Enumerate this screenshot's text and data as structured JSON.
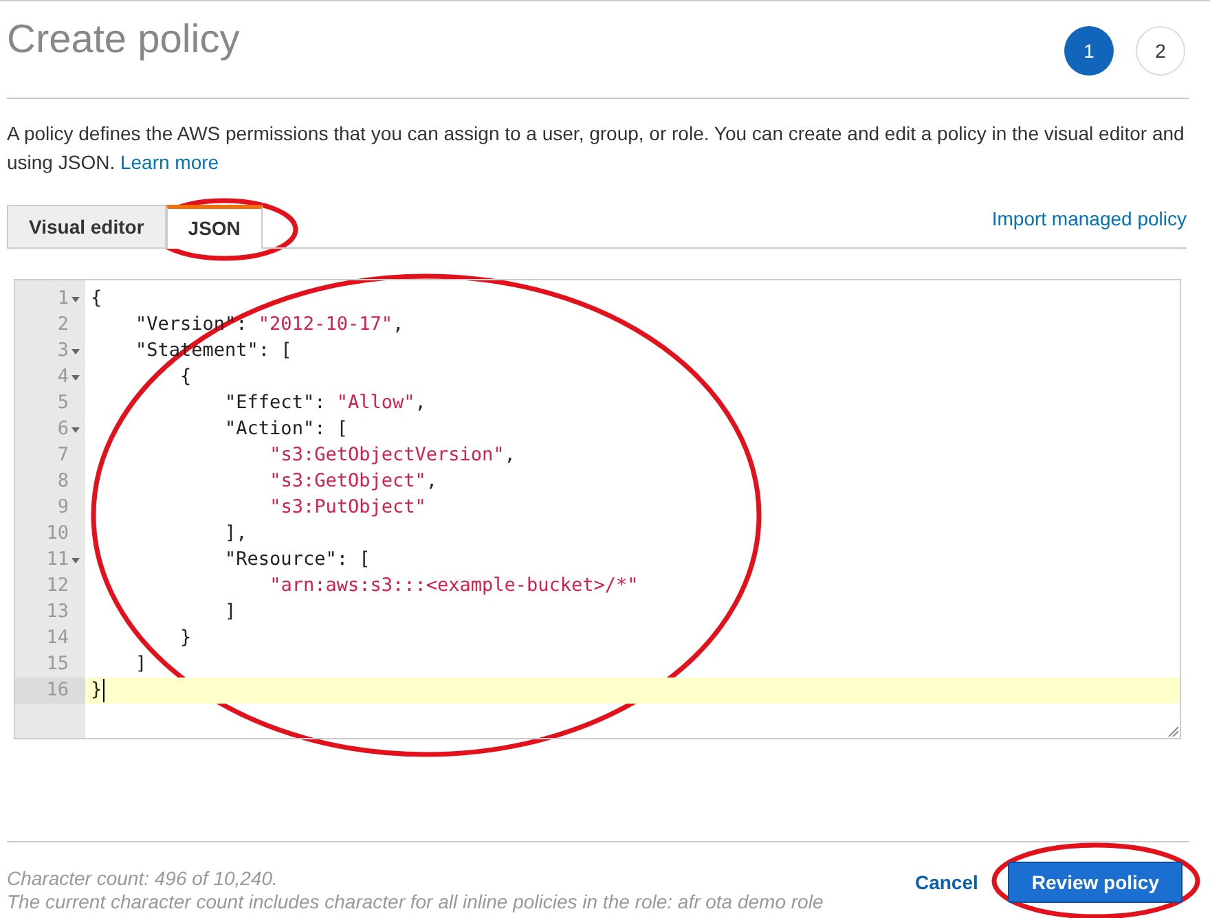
{
  "title": "Create policy",
  "steps": [
    {
      "label": "1",
      "selected": true
    },
    {
      "label": "2",
      "selected": false
    }
  ],
  "description": {
    "text": "A policy defines the AWS permissions that you can assign to a user, group, or role. You can create and edit a policy in the visual editor and using JSON.",
    "link": "Learn more"
  },
  "tabs": [
    {
      "label": "Visual editor",
      "selected": false
    },
    {
      "label": "JSON",
      "selected": true
    }
  ],
  "import_link": "Import managed policy",
  "editor": {
    "lines": [
      {
        "number": "1",
        "foldable": true,
        "active": false,
        "segments": [
          {
            "kind": "punct",
            "text": "{"
          }
        ],
        "children": [
          {
            "number": "2",
            "foldable": false,
            "active": false,
            "segments": [
              {
                "kind": "punct",
                "text": "\"Version\": "
              },
              {
                "kind": "string",
                "text": "\"2012-10-17\""
              },
              {
                "kind": "punct",
                "text": ","
              }
            ]
          },
          {
            "number": "3",
            "foldable": true,
            "active": false,
            "segments": [
              {
                "kind": "punct",
                "text": "\"Statement\": ["
              }
            ],
            "children": [
              {
                "number": "4",
                "foldable": true,
                "active": false,
                "segments": [
                  {
                    "kind": "punct",
                    "text": "{"
                  }
                ],
                "children": [
                  {
                    "number": "5",
                    "foldable": false,
                    "active": false,
                    "segments": [
                      {
                        "kind": "punct",
                        "text": "\"Effect\": "
                      },
                      {
                        "kind": "string",
                        "text": "\"Allow\""
                      },
                      {
                        "kind": "punct",
                        "text": ","
                      }
                    ]
                  },
                  {
                    "number": "6",
                    "foldable": true,
                    "active": false,
                    "segments": [
                      {
                        "kind": "punct",
                        "text": "\"Action\": ["
                      }
                    ],
                    "children": [
                      {
                        "number": "7",
                        "foldable": false,
                        "active": false,
                        "segments": [
                          {
                            "kind": "string",
                            "text": "\"s3:GetObjectVersion\""
                          },
                          {
                            "kind": "punct",
                            "text": ","
                          }
                        ]
                      },
                      {
                        "number": "8",
                        "foldable": false,
                        "active": false,
                        "segments": [
                          {
                            "kind": "string",
                            "text": "\"s3:GetObject\""
                          },
                          {
                            "kind": "punct",
                            "text": ","
                          }
                        ]
                      },
                      {
                        "number": "9",
                        "foldable": false,
                        "active": false,
                        "segments": [
                          {
                            "kind": "string",
                            "text": "\"s3:PutObject\""
                          }
                        ]
                      }
                    ]
                  },
                  {
                    "number": "10",
                    "foldable": false,
                    "active": false,
                    "segments": [
                      {
                        "kind": "punct",
                        "text": "],"
                      }
                    ]
                  },
                  {
                    "number": "11",
                    "foldable": true,
                    "active": false,
                    "segments": [
                      {
                        "kind": "punct",
                        "text": "\"Resource\": ["
                      }
                    ],
                    "children": [
                      {
                        "number": "12",
                        "foldable": false,
                        "active": false,
                        "segments": [
                          {
                            "kind": "string",
                            "text": "\"arn:aws:s3:::<example-bucket>/*\""
                          }
                        ]
                      }
                    ]
                  },
                  {
                    "number": "13",
                    "foldable": false,
                    "active": false,
                    "segments": [
                      {
                        "kind": "punct",
                        "text": "]"
                      }
                    ]
                  }
                ]
              },
              {
                "number": "14",
                "foldable": false,
                "active": false,
                "segments": [
                  {
                    "kind": "punct",
                    "text": "}"
                  }
                ]
              }
            ]
          },
          {
            "number": "15",
            "foldable": false,
            "active": false,
            "segments": [
              {
                "kind": "punct",
                "text": "]"
              }
            ]
          }
        ]
      },
      {
        "number": "16",
        "foldable": false,
        "active": true,
        "segments": [
          {
            "kind": "punct",
            "text": "}"
          }
        ]
      }
    ]
  },
  "footer": {
    "count": "Character count: 496 of 10,240.",
    "note": "The current character count includes character for all inline policies in the role: afr ota demo role"
  },
  "buttons": [
    {
      "label": "Cancel",
      "kind": "link"
    },
    {
      "label": "Review policy",
      "kind": "primary"
    }
  ]
}
